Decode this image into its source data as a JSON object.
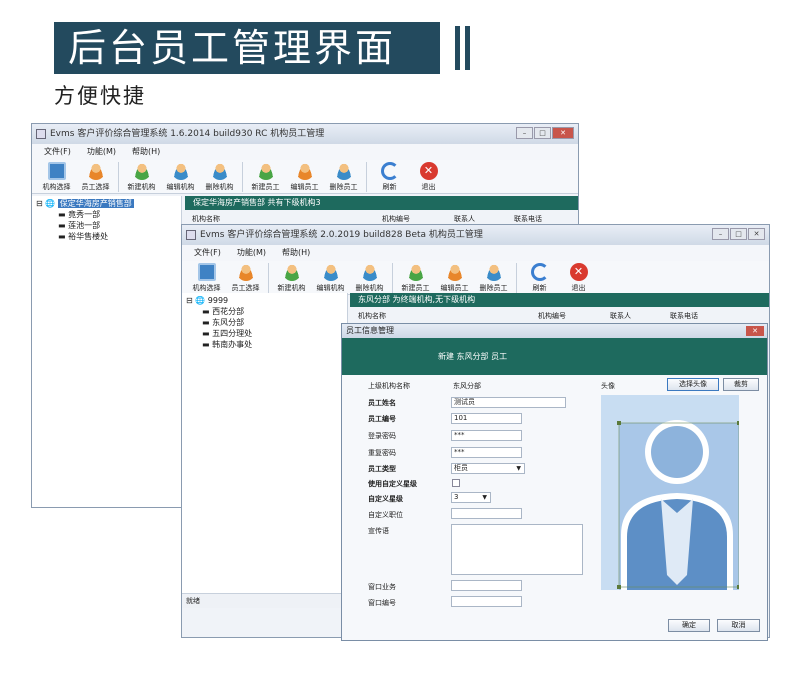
{
  "banner": {
    "title": "后台员工管理界面",
    "subtitle": "方便快捷"
  },
  "back_window": {
    "title": "Evms 客户评价综合管理系统 1.6.2014 build930 RC 机构员工管理",
    "menu": [
      "文件(F)",
      "功能(M)",
      "帮助(H)"
    ],
    "toolbar": [
      "机构选择",
      "员工选择",
      "新建机构",
      "编辑机构",
      "删除机构",
      "新建员工",
      "编辑员工",
      "删除员工",
      "刷新",
      "退出"
    ],
    "tree": {
      "root": "保定华海房产销售部",
      "children": [
        "竟秀一部",
        "莲池一部",
        "裕华售楼处"
      ]
    },
    "info_bar": "保定华海房产销售部 共有下级机构3",
    "columns": [
      "机构名称",
      "机构编号",
      "联系人",
      "联系电话"
    ]
  },
  "front_window": {
    "title": "Evms 客户评价综合管理系统 2.0.2019 build828 Beta 机构员工管理",
    "menu": [
      "文件(F)",
      "功能(M)",
      "帮助(H)"
    ],
    "toolbar": [
      "机构选择",
      "员工选择",
      "新建机构",
      "编辑机构",
      "删除机构",
      "新建员工",
      "编辑员工",
      "删除员工",
      "刷新",
      "退出"
    ],
    "tree": {
      "root": "9999",
      "children": [
        "西花分部",
        "东风分部",
        "五四分理处",
        "韩南办事处"
      ]
    },
    "info_bar": "东风分部 为终端机构,无下级机构",
    "columns": [
      "机构名称",
      "机构编号",
      "联系人",
      "联系电话"
    ],
    "status": "就绪"
  },
  "dialog": {
    "title": "员工信息管理",
    "header": "新建 东风分部 员工",
    "fields": {
      "parent_org_label": "上级机构名称",
      "parent_org_value": "东风分部",
      "name_label": "员工姓名",
      "name_value": "测试员",
      "id_label": "员工编号",
      "id_value": "101",
      "login_pw_label": "登录密码",
      "login_pw_value": "***",
      "repeat_pw_label": "重复密码",
      "repeat_pw_value": "***",
      "type_label": "员工类型",
      "type_value": "柜员",
      "custom_star_label": "使用自定义星级",
      "star_label": "自定义星级",
      "star_value": "3",
      "position_label": "自定义职位",
      "slogan_label": "宣传语",
      "window_business_label": "窗口业务",
      "window_no_label": "窗口编号"
    },
    "photo_label": "头像",
    "select_photo_button": "选择头像",
    "crop_button": "裁剪",
    "ok_button": "确定",
    "cancel_button": "取消"
  },
  "colors": {
    "banner": "#234a5e",
    "teal": "#1e6a5e",
    "selection": "#3b79c0"
  }
}
